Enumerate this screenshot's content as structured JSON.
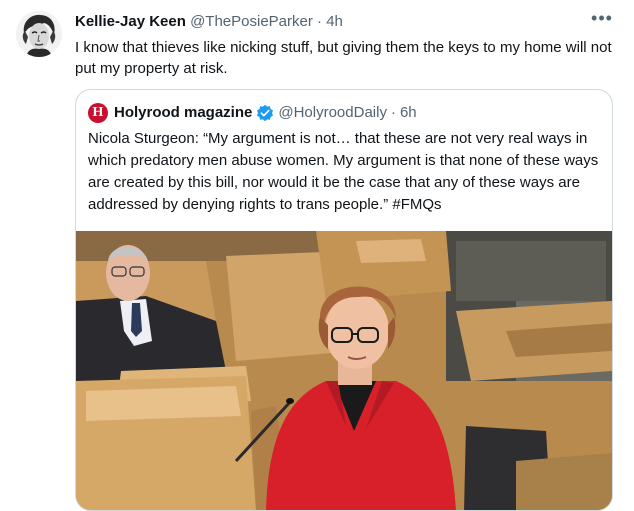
{
  "tweet": {
    "author_name": "Kellie-Jay Keen",
    "author_handle": "@ThePosieParker",
    "separator": "·",
    "time": "4h",
    "more_label": "•••",
    "text": "I know that thieves like nicking stuff, but giving them the keys to my home will not put my property at risk."
  },
  "quote": {
    "logo_letter": "H",
    "author_name": "Holyrood magazine",
    "author_handle": "@HolyroodDaily",
    "separator": "·",
    "time": "6h",
    "text": "Nicola Sturgeon: “My argument is not… that these are not very real ways in which predatory men abuse women. My argument is that none of these ways are created by this bill, nor would it be the case that any of these ways are addressed by denying rights to trans people.” #FMQs"
  },
  "colors": {
    "verified": "#1d9bf0",
    "holyrood_red": "#c8102e",
    "secondary_text": "#536471",
    "border": "#cfd9de"
  }
}
